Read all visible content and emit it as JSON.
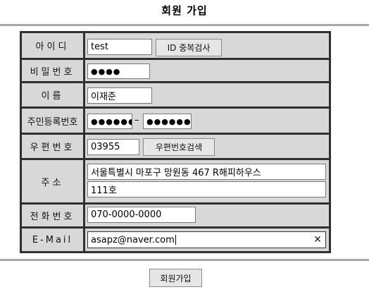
{
  "page": {
    "title": "회원 가입",
    "submit_label": "회원가입"
  },
  "form": {
    "id_label": "아이디",
    "id_value": "test",
    "id_check_label": "ID 중복검사",
    "password_label": "비밀번호",
    "password_mask": "●●●●",
    "name_label": "이름",
    "name_value": "이재준",
    "resident_label": "주민등록번호",
    "resident_front_mask": "●●●●●●",
    "resident_separator": "–",
    "resident_back_mask": "●●●●●●●",
    "zip_label": "우편번호",
    "zip_value": "03955",
    "zip_search_label": "우편번호검색",
    "address_label": "주소",
    "address_line1": "서울특별시 마포구 망원동 467 R해피하우스",
    "address_line2": "111호",
    "phone_label": "전화번호",
    "phone_value": "070-0000-0000",
    "email_label": "E-Mail",
    "email_value": "asapz@naver.com",
    "clear_symbol": "✕"
  }
}
